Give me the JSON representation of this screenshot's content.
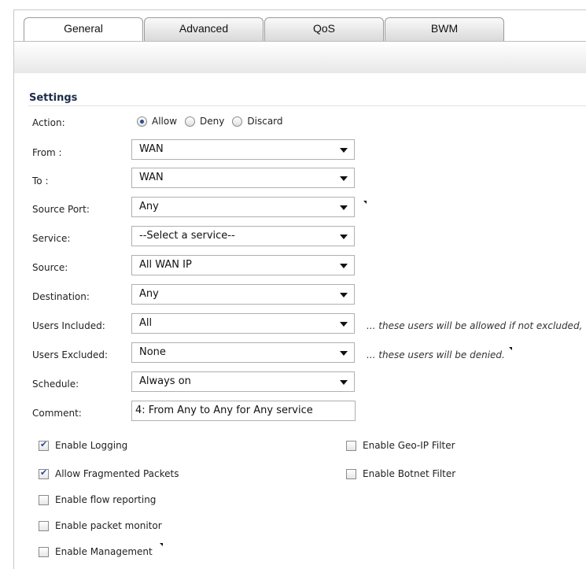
{
  "tabs": [
    {
      "label": "General",
      "active": true
    },
    {
      "label": "Advanced",
      "active": false
    },
    {
      "label": "QoS",
      "active": false
    },
    {
      "label": "BWM",
      "active": false
    }
  ],
  "section_title": "Settings",
  "action": {
    "label": "Action:",
    "options": [
      "Allow",
      "Deny",
      "Discard"
    ],
    "selected": "Allow"
  },
  "fields": {
    "from": {
      "label": "From :",
      "value": "WAN"
    },
    "to": {
      "label": "To :",
      "value": "WAN"
    },
    "source_port": {
      "label": "Source Port:",
      "value": "Any"
    },
    "service": {
      "label": "Service:",
      "value": "--Select a service--"
    },
    "source": {
      "label": "Source:",
      "value": "All WAN IP"
    },
    "destination": {
      "label": "Destination:",
      "value": "Any"
    },
    "users_included": {
      "label": "Users Included:",
      "value": "All",
      "note": "... these users will be allowed if not excluded,"
    },
    "users_excluded": {
      "label": "Users Excluded:",
      "value": "None",
      "note": "... these users will be denied."
    },
    "schedule": {
      "label": "Schedule:",
      "value": "Always on"
    },
    "comment": {
      "label": "Comment:",
      "value": "4: From Any to Any for Any service"
    }
  },
  "checkboxes": {
    "enable_logging": {
      "label": "Enable Logging",
      "checked": true
    },
    "allow_fragmented": {
      "label": "Allow Fragmented Packets",
      "checked": true
    },
    "flow_reporting": {
      "label": "Enable flow reporting",
      "checked": false
    },
    "packet_monitor": {
      "label": "Enable packet monitor",
      "checked": false
    },
    "management": {
      "label": "Enable Management",
      "checked": false
    },
    "geo_ip": {
      "label": "Enable Geo-IP Filter",
      "checked": false
    },
    "botnet": {
      "label": "Enable Botnet Filter",
      "checked": false
    }
  },
  "colors": {
    "section_title": "#1c2d4a",
    "check": "#244a9a"
  }
}
